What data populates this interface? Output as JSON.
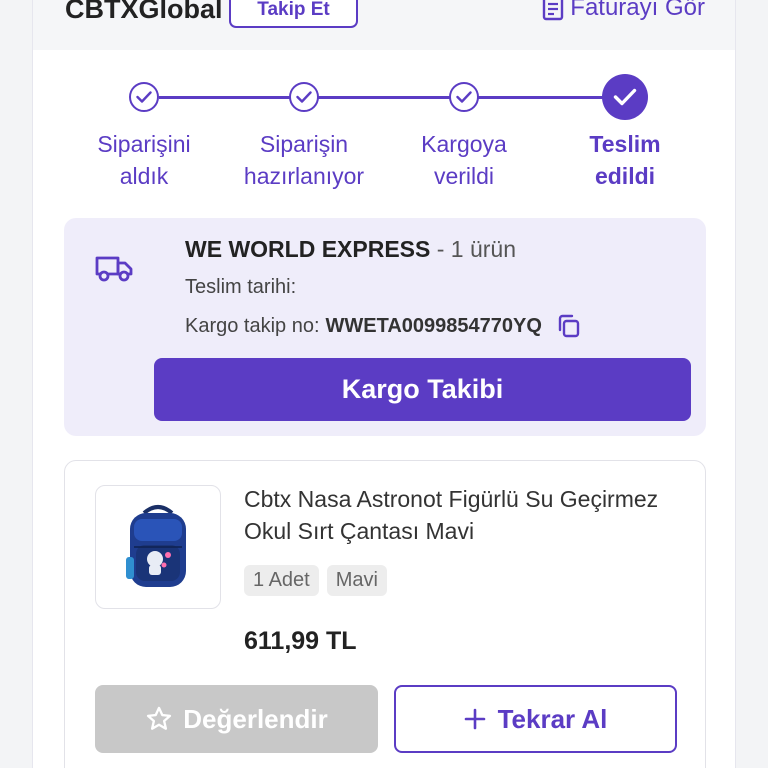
{
  "header": {
    "seller_name": "CBTXGlobal",
    "follow_label": "Takip Et",
    "invoice_label": "Faturayı Gör"
  },
  "tracker": {
    "steps": [
      {
        "line1": "Siparişini",
        "line2": "aldık",
        "state": "completed"
      },
      {
        "line1": "Siparişin",
        "line2": "hazırlanıyor",
        "state": "completed"
      },
      {
        "line1": "Kargoya",
        "line2": "verildi",
        "state": "completed"
      },
      {
        "line1": "Teslim",
        "line2": "edildi",
        "state": "current"
      }
    ]
  },
  "cargo": {
    "company": "WE WORLD EXPRESS",
    "item_count": "- 1 ürün",
    "delivery_date_label": "Teslim tarihi:",
    "tracking_label": "Kargo takip no:",
    "tracking_number": "WWETA0099854770YQ",
    "track_button": "Kargo Takibi"
  },
  "product": {
    "title": "Cbtx Nasa Astronot Figürlü Su Geçirmez Okul Sırt Çantası Mavi",
    "quantity": "1 Adet",
    "color": "Mavi",
    "price": "611,99 TL",
    "rate_button": "Değerlendir",
    "rebuy_button": "Tekrar Al"
  },
  "colors": {
    "accent": "#5b3cc4",
    "cargo_bg": "#efedfa",
    "disabled": "#c8c8c8"
  },
  "icons": [
    "invoice-icon",
    "check-icon",
    "truck-icon",
    "copy-icon",
    "star-icon",
    "plus-icon"
  ]
}
